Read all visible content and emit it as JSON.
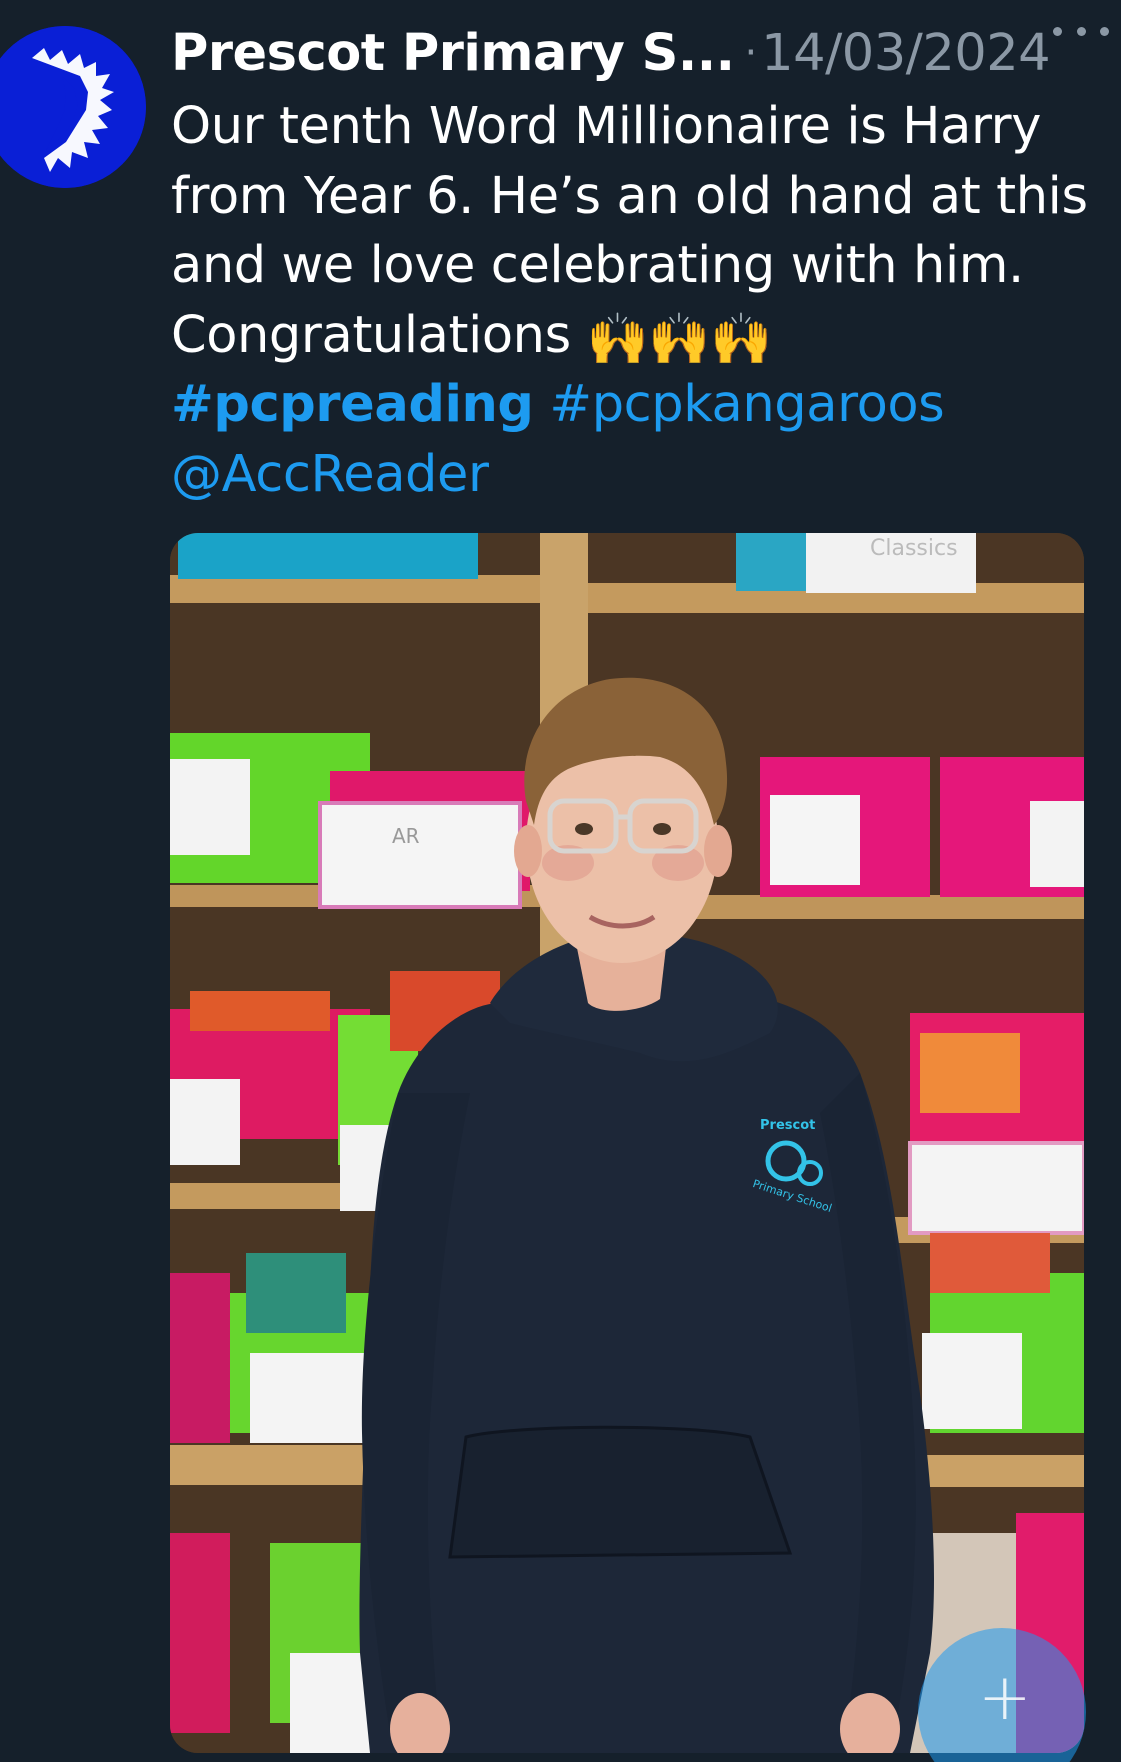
{
  "tweet": {
    "author_name": "Prescot Primary S...",
    "separator": "·",
    "timestamp": "14/03/2024",
    "text_lines": [
      "Our tenth Word Millionaire is Harry",
      "from Year 6.  He’s an old hand at this",
      "and we love celebrating with him.",
      "Congratulations"
    ],
    "emoji": "🙌🙌🙌",
    "hashtags": [
      "#pcpreading",
      "#pcpkangaroos"
    ],
    "mention": "@AccReader"
  },
  "media": {
    "hoodie_logo_top": "Prescot",
    "hoodie_logo_bottom": "Primary School",
    "shelf_label": "AR",
    "top_box_label": "Classics"
  },
  "fab": {
    "icon": "plus-icon",
    "glyph": "+"
  },
  "colors": {
    "background": "#15202b",
    "accent": "#1d9bf0",
    "muted": "#8b98a5",
    "avatar": "#0a1fd6"
  }
}
